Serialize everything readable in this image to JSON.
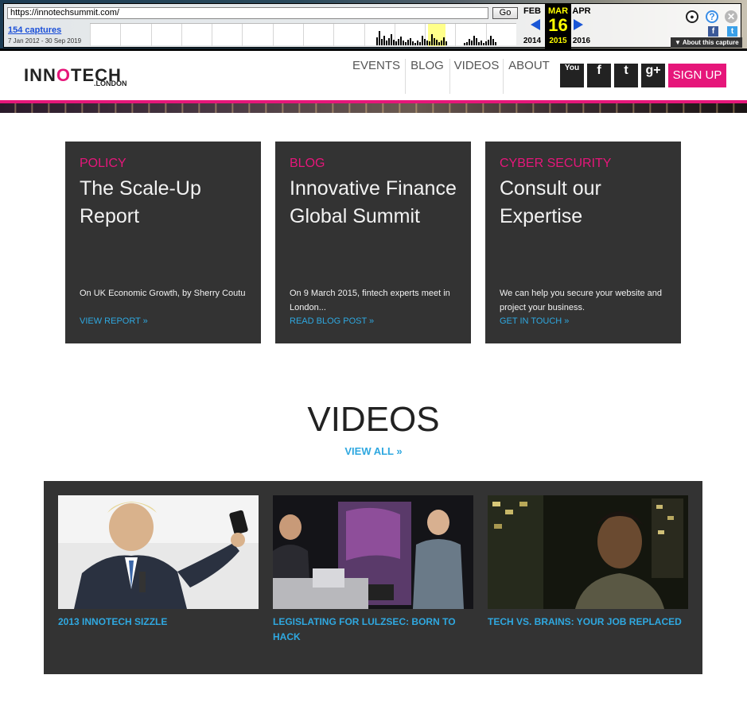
{
  "wayback": {
    "url": "https://innotechsummit.com/",
    "go_label": "Go",
    "captures": "154 captures",
    "range": "7 Jan 2012 - 30 Sep 2019",
    "prev_month": "FEB",
    "prev_year": "2014",
    "cur_month": "MAR",
    "cur_day": "16",
    "cur_year": "2015",
    "next_month": "APR",
    "next_year": "2016",
    "about_label": "About this capture",
    "facebook_glyph": "f",
    "twitter_glyph": "t",
    "help_glyph": "?",
    "close_glyph": "✕",
    "user_glyph": "●"
  },
  "header": {
    "logo_main": "INNOTECH",
    "logo_sub": ".LONDON",
    "nav": [
      "EVENTS",
      "BLOG",
      "VIDEOS",
      "ABOUT"
    ],
    "social": [
      {
        "name": "youtube",
        "glyph": "You"
      },
      {
        "name": "facebook",
        "glyph": "f"
      },
      {
        "name": "twitter",
        "glyph": "t"
      },
      {
        "name": "googleplus",
        "glyph": "g+"
      }
    ],
    "signup_label": "SIGN UP"
  },
  "cards": [
    {
      "tag": "POLICY",
      "title": "The Scale-Up Report",
      "desc": "On UK Economic Growth, by Sherry Coutu",
      "link": "VIEW REPORT »"
    },
    {
      "tag": "BLOG",
      "title": "Innovative Finance Global Summit",
      "desc": "On 9 March 2015, fintech experts meet in London...",
      "link": "READ BLOG POST »"
    },
    {
      "tag": "CYBER SECURITY",
      "title": "Consult our Expertise",
      "desc": "We can help you secure your website and project your business.",
      "link": "GET IN TOUCH »"
    }
  ],
  "videos": {
    "title": "VIDEOS",
    "view_all": "VIEW ALL »",
    "items": [
      {
        "title": "2013 INNOTECH SIZZLE"
      },
      {
        "title": "LEGISLATING FOR LULZSEC: BORN TO HACK"
      },
      {
        "title": "TECH VS. BRAINS: YOUR JOB REPLACED"
      }
    ]
  },
  "colors": {
    "accent": "#e6167a",
    "link": "#2fa8e0",
    "card_bg": "#333333"
  }
}
